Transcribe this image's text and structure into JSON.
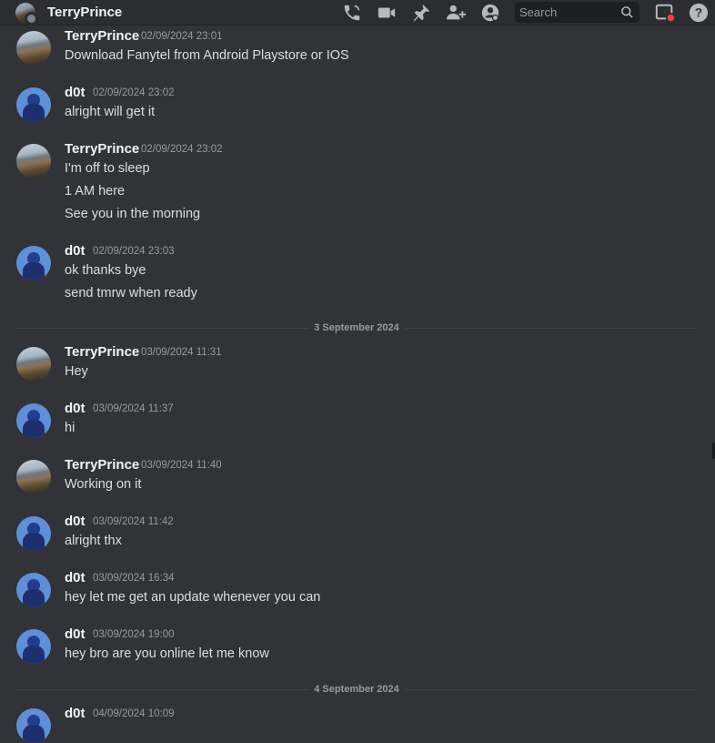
{
  "header": {
    "title": "TerryPrince",
    "search_placeholder": "Search",
    "icons": [
      "call-icon",
      "video-icon",
      "pin-icon",
      "add-member-icon",
      "profile-icon",
      "inbox-icon",
      "help-icon"
    ]
  },
  "colors": {
    "background": "#313338",
    "header": "#2b2d31",
    "text": "#dbdee1",
    "muted": "#949ba4",
    "alert": "#f23f43"
  },
  "messages": [
    {
      "author": "TerryPrince",
      "timestamp": "02/09/2024 23:01",
      "lines": [
        "Download Fanytel from Android Playstore or IOS"
      ]
    },
    {
      "author": "d0t",
      "timestamp": "02/09/2024 23:02",
      "lines": [
        "alright will get it"
      ]
    },
    {
      "author": "TerryPrince",
      "timestamp": "02/09/2024 23:02",
      "lines": [
        "I'm off to sleep",
        "1 AM here",
        "See you in the morning"
      ]
    },
    {
      "author": "d0t",
      "timestamp": "02/09/2024 23:03",
      "lines": [
        "ok thanks bye",
        "send tmrw when ready"
      ]
    },
    {
      "author": "TerryPrince",
      "timestamp": "03/09/2024 11:31",
      "lines": [
        "Hey"
      ]
    },
    {
      "author": "d0t",
      "timestamp": "03/09/2024 11:37",
      "lines": [
        "hi"
      ]
    },
    {
      "author": "TerryPrince",
      "timestamp": "03/09/2024 11:40",
      "lines": [
        "Working on it"
      ]
    },
    {
      "author": "d0t",
      "timestamp": "03/09/2024 11:42",
      "lines": [
        "alright thx"
      ]
    },
    {
      "author": "d0t",
      "timestamp": "03/09/2024 16:34",
      "lines": [
        "hey let me get an update whenever you can"
      ]
    },
    {
      "author": "d0t",
      "timestamp": "03/09/2024 19:00",
      "lines": [
        "hey bro are you online let me know"
      ]
    },
    {
      "author": "d0t",
      "timestamp": "04/09/2024 10:09",
      "lines": []
    }
  ],
  "dividers": [
    "3 September 2024",
    "4 September 2024"
  ]
}
